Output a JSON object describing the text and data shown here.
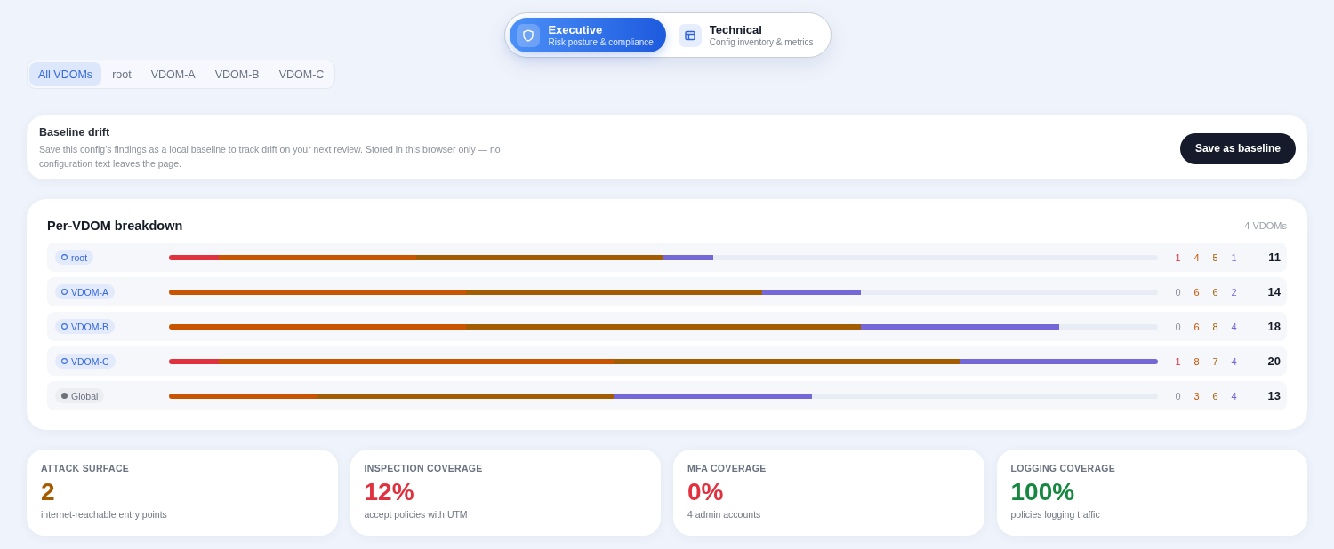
{
  "view_switch": {
    "options": [
      {
        "label": "Executive",
        "subtitle": "Risk posture & compliance",
        "selected": true
      },
      {
        "label": "Technical",
        "subtitle": "Config inventory & metrics",
        "selected": false
      }
    ]
  },
  "vdom_tabs": [
    {
      "label": "All VDOMs",
      "selected": true
    },
    {
      "label": "root",
      "selected": false
    },
    {
      "label": "VDOM-A",
      "selected": false
    },
    {
      "label": "VDOM-B",
      "selected": false
    },
    {
      "label": "VDOM-C",
      "selected": false
    }
  ],
  "baseline": {
    "title": "Baseline drift",
    "description": "Save this config’s findings as a local baseline to track drift on your next review. Stored in this browser only — no configuration text leaves the page.",
    "button": "Save as baseline"
  },
  "breakdown": {
    "title": "Per-VDOM breakdown",
    "count": "4 VDOMs",
    "rows": [
      {
        "name": "root",
        "kind": "vdom",
        "severities": [
          {
            "count": "1",
            "color": "#e0313f"
          },
          {
            "count": "4",
            "color": "#c85400"
          },
          {
            "count": "5",
            "color": "#a45c00"
          },
          {
            "count": "1",
            "color": "#7468d8"
          }
        ],
        "total": "11"
      },
      {
        "name": "VDOM-A",
        "kind": "vdom",
        "severities": [
          {
            "count": "0",
            "color": "#8d9099"
          },
          {
            "count": "6",
            "color": "#c85400"
          },
          {
            "count": "6",
            "color": "#a45c00"
          },
          {
            "count": "2",
            "color": "#7468d8"
          }
        ],
        "total": "14"
      },
      {
        "name": "VDOM-B",
        "kind": "vdom",
        "severities": [
          {
            "count": "0",
            "color": "#8d9099"
          },
          {
            "count": "6",
            "color": "#c85400"
          },
          {
            "count": "8",
            "color": "#a45c00"
          },
          {
            "count": "4",
            "color": "#7468d8"
          }
        ],
        "total": "18"
      },
      {
        "name": "VDOM-C",
        "kind": "vdom",
        "severities": [
          {
            "count": "1",
            "color": "#e0313f"
          },
          {
            "count": "8",
            "color": "#c85400"
          },
          {
            "count": "7",
            "color": "#a45c00"
          },
          {
            "count": "4",
            "color": "#7468d8"
          }
        ],
        "total": "20"
      },
      {
        "name": "Global",
        "kind": "global",
        "severities": [
          {
            "count": "0",
            "color": "#8d9099"
          },
          {
            "count": "3",
            "color": "#c85400"
          },
          {
            "count": "6",
            "color": "#a45c00"
          },
          {
            "count": "4",
            "color": "#7468d8"
          }
        ],
        "total": "13"
      }
    ]
  },
  "stats": [
    {
      "label": "ATTACK SURFACE",
      "value": "2",
      "caption": "internet-reachable entry points",
      "color": "#a35c00"
    },
    {
      "label": "INSPECTION COVERAGE",
      "value": "12%",
      "caption": "accept policies with UTM",
      "color": "#e0313f"
    },
    {
      "label": "MFA COVERAGE",
      "value": "0%",
      "caption": "4 admin accounts",
      "color": "#e0313f"
    },
    {
      "label": "LOGGING COVERAGE",
      "value": "100%",
      "caption": "policies logging traffic",
      "color": "#16873f"
    }
  ]
}
